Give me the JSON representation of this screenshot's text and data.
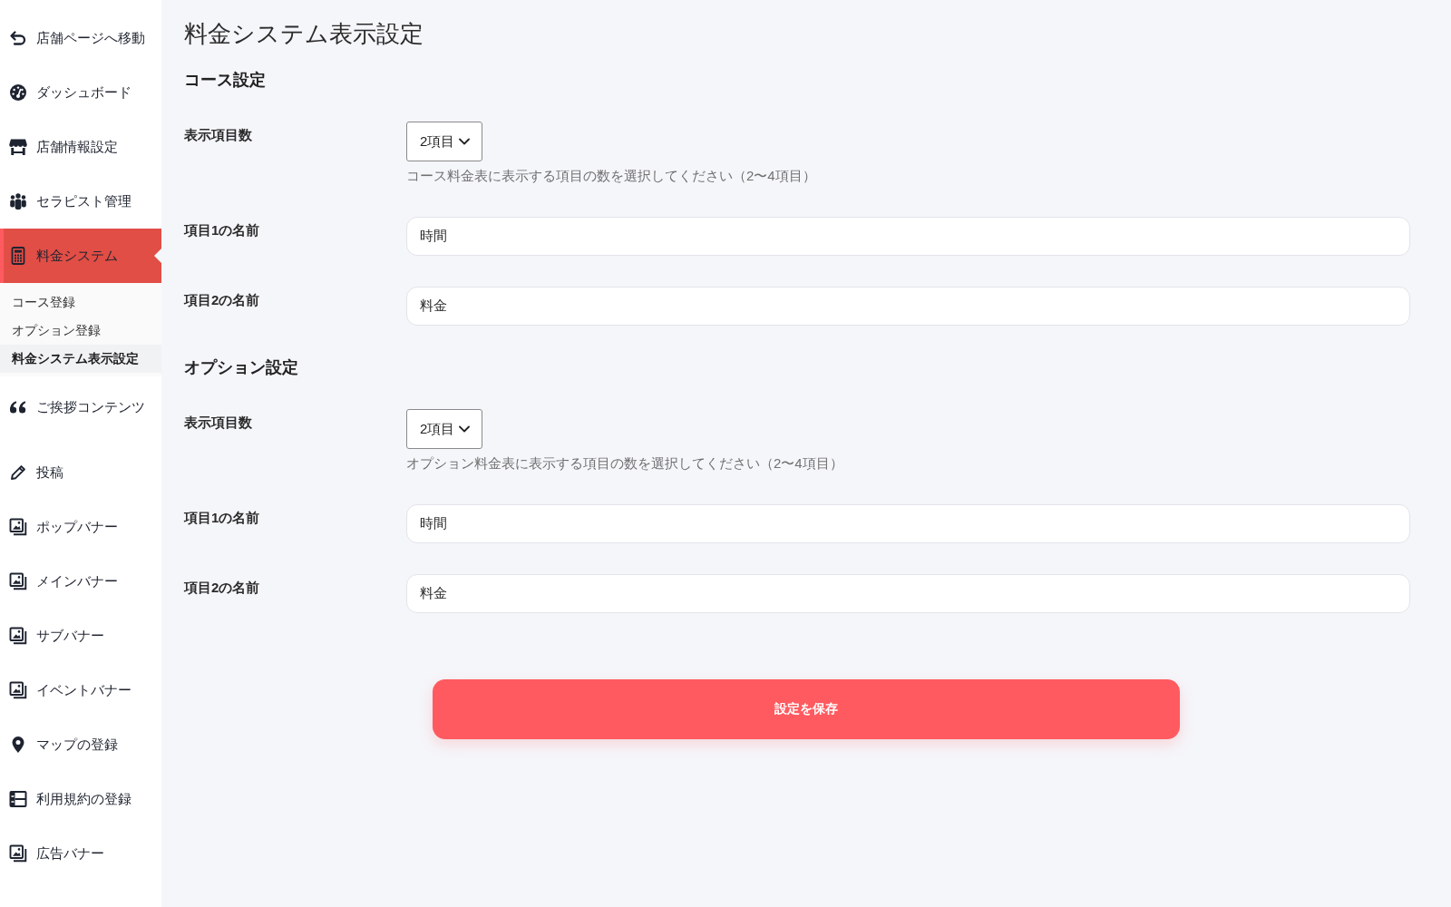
{
  "sidebar": {
    "items": [
      {
        "label": "店舗ページへ移動",
        "selected": false
      },
      {
        "label": "ダッシュボード",
        "selected": false
      },
      {
        "label": "店舗情報設定",
        "selected": false
      },
      {
        "label": "セラピスト管理",
        "selected": false
      },
      {
        "label": "料金システム",
        "selected": true,
        "children": [
          {
            "label": "コース登録",
            "selected": false
          },
          {
            "label": "オプション登録",
            "selected": false
          },
          {
            "label": "料金システム表示設定",
            "selected": true
          }
        ]
      },
      {
        "label": "ご挨拶コンテンツ",
        "selected": false
      },
      {
        "label": "投稿",
        "selected": false
      },
      {
        "label": "ポップバナー",
        "selected": false
      },
      {
        "label": "メインバナー",
        "selected": false
      },
      {
        "label": "サブバナー",
        "selected": false
      },
      {
        "label": "イベントバナー",
        "selected": false
      },
      {
        "label": "マップの登録",
        "selected": false
      },
      {
        "label": "利用規約の登録",
        "selected": false
      },
      {
        "label": "広告バナー",
        "selected": false
      }
    ]
  },
  "page": {
    "title": "料金システム表示設定"
  },
  "sections": [
    {
      "heading": "コース設定",
      "fields": [
        {
          "kind": "select",
          "label": "表示項目数",
          "value": "2項目",
          "hint": "コース料金表に表示する項目の数を選択してください（2〜4項目）"
        },
        {
          "kind": "text",
          "label": "項目1の名前",
          "value": "時間"
        },
        {
          "kind": "text",
          "label": "項目2の名前",
          "value": "料金"
        }
      ]
    },
    {
      "heading": "オプション設定",
      "fields": [
        {
          "kind": "select",
          "label": "表示項目数",
          "value": "2項目",
          "hint": "オプション料金表に表示する項目の数を選択してください（2〜4項目）"
        },
        {
          "kind": "text",
          "label": "項目1の名前",
          "value": "時間"
        },
        {
          "kind": "text",
          "label": "項目2の名前",
          "value": "料金"
        }
      ]
    }
  ],
  "save_button": {
    "label": "設定を保存"
  }
}
